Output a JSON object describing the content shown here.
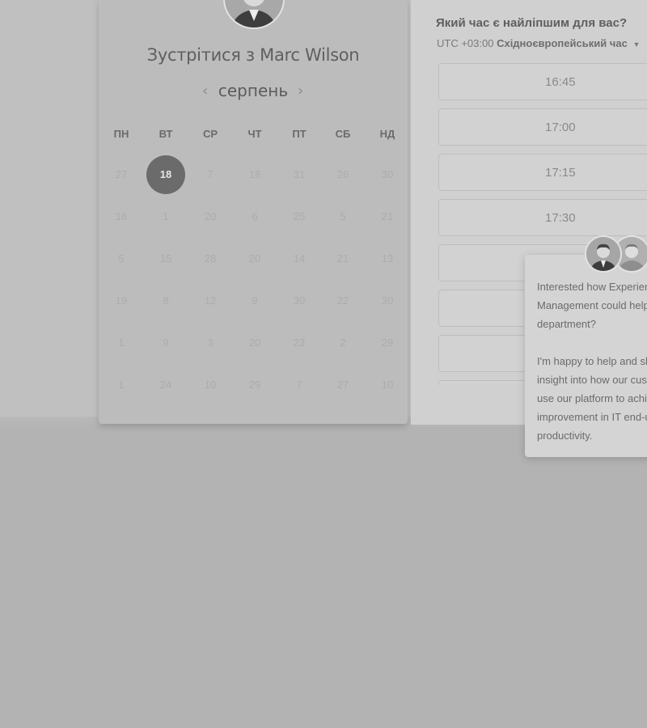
{
  "scheduler": {
    "title": "Зустрітися з Marc Wilson",
    "month": "серпень",
    "prev_icon": "‹",
    "next_icon": "›",
    "weekdays": [
      "ПН",
      "ВТ",
      "СР",
      "ЧТ",
      "ПТ",
      "СБ",
      "НД"
    ],
    "weeks": [
      [
        "27",
        "18",
        "7",
        "18",
        "31",
        "26",
        "30"
      ],
      [
        "16",
        "1",
        "20",
        "6",
        "25",
        "5",
        "21"
      ],
      [
        "5",
        "15",
        "28",
        "20",
        "14",
        "21",
        "13"
      ],
      [
        "19",
        "8",
        "12",
        "9",
        "30",
        "22",
        "30"
      ],
      [
        "1",
        "9",
        "3",
        "20",
        "23",
        "2",
        "29"
      ],
      [
        "1",
        "24",
        "10",
        "29",
        "7",
        "27",
        "10"
      ]
    ],
    "selected_day": "18"
  },
  "time_panel": {
    "question": "Який час є найліпшим для вас?",
    "tz_offset": "UTC +03:00",
    "tz_name": "Східноєвропейський час",
    "tz_caret": "▼",
    "slots": [
      "16:45",
      "17:00",
      "17:15",
      "17:30",
      "",
      "",
      "",
      ""
    ]
  },
  "chat": {
    "lines": [
      "Interested how Experience",
      "Management could help your",
      "department?",
      "",
      "I'm happy to help and share",
      "insight into how our customers",
      "use our platform to achieve",
      "improvement in IT end-user",
      "productivity."
    ]
  },
  "colors": {
    "overlay_background": "#b3b3b3",
    "selected_day": "#6b6b6b"
  }
}
